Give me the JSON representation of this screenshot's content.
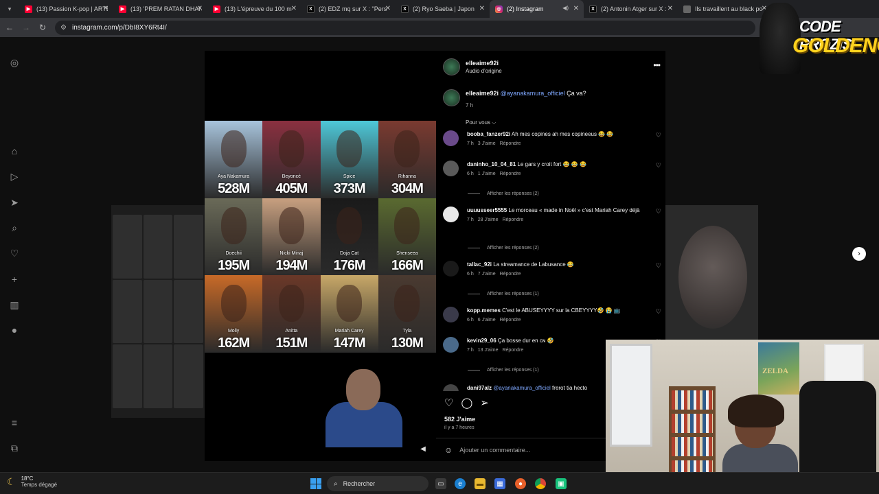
{
  "tabs": [
    {
      "title": "(13) Passion K-pop | ARTE",
      "favicon": "youtube",
      "active": false
    },
    {
      "title": "(13) 'PREM RATAN DHAN",
      "favicon": "youtube",
      "active": false
    },
    {
      "title": "(13) L'épreuve du 100 m",
      "favicon": "youtube",
      "active": false
    },
    {
      "title": "(2) EDZ mq sur X : \"Pers",
      "favicon": "x",
      "active": false
    },
    {
      "title": "(2) Ryo Saeba | Japon",
      "favicon": "x",
      "active": false
    },
    {
      "title": "(2) Instagram",
      "favicon": "instagram",
      "active": true
    },
    {
      "title": "(2) Antonin Atger sur X :",
      "favicon": "x",
      "active": false
    },
    {
      "title": "Ils travaillent au black po",
      "favicon": "none",
      "active": false
    }
  ],
  "url": "instagram.com/p/DbI8XY6Rt4I/",
  "reel": {
    "artists": [
      {
        "name": "Aya Nakamura",
        "streams": "528M",
        "color": "#a8c4dc"
      },
      {
        "name": "Beyoncé",
        "streams": "405M",
        "color": "#8a3040"
      },
      {
        "name": "Spice",
        "streams": "373M",
        "color": "#4ec8d8"
      },
      {
        "name": "Rihanna",
        "streams": "304M",
        "color": "#7a3a30"
      },
      {
        "name": "Doechii",
        "streams": "195M",
        "color": "#6a6a58"
      },
      {
        "name": "Nicki Minaj",
        "streams": "194M",
        "color": "#c8a080"
      },
      {
        "name": "Doja Cat",
        "streams": "176M",
        "color": "#1a1a1a"
      },
      {
        "name": "Shenseea",
        "streams": "166M",
        "color": "#5a6a30"
      },
      {
        "name": "Moliy",
        "streams": "162M",
        "color": "#c86a28"
      },
      {
        "name": "Anitta",
        "streams": "151M",
        "color": "#6a3828"
      },
      {
        "name": "Mariah Carey",
        "streams": "147M",
        "color": "#c8a868"
      },
      {
        "name": "Tyla",
        "streams": "130M",
        "color": "#4a3a30"
      }
    ]
  },
  "post": {
    "username": "elleaime92i",
    "audio": "Audio d'origine",
    "caption_user": "elleaime92i",
    "caption_mention": "@ayanakamura_officiel",
    "caption_text": " Ça va?",
    "caption_time": "7 h",
    "for_you": "Pour vous ⌵",
    "comments": [
      {
        "user": "booba_fanzer92i",
        "text": " Ah mes copines ah mes copineeus 😂 😂",
        "time": "7 h",
        "likes": "3 J'aime",
        "reply": "Répondre",
        "color": "#6a4a8a"
      },
      {
        "user": "daninho_10_04_81",
        "text": " Le gars y croit fort 😂 😂 😂",
        "time": "6 h",
        "likes": "1 J'aime",
        "reply": "Répondre",
        "color": "#5a5a5a"
      },
      {
        "user": "uuuusseer5555",
        "text": " Le morceau « made in Noël » c'est Mariah Carey déjà",
        "time": "7 h",
        "likes": "28 J'aime",
        "reply": "Répondre",
        "color": "#e8e8e8"
      },
      {
        "user": "tallac_92i",
        "text": " La streamance de Labusance 😂",
        "time": "6 h",
        "likes": "7 J'aime",
        "reply": "Répondre",
        "color": "#1a1a1a"
      },
      {
        "user": "kopp.memes",
        "text": " C'est le ABUSEYYYY sur la CBEYYYY🤣 😭 📺",
        "time": "6 h",
        "likes": "6 J'aime",
        "reply": "Répondre",
        "color": "#3a3a4a"
      },
      {
        "user": "kevin29_06",
        "text": " Ça bosse dur en ᴄɴ 🤣",
        "time": "7 h",
        "likes": "13 J'aime",
        "reply": "Répondre",
        "color": "#4a6a8a"
      }
    ],
    "replies": [
      "Afficher les réponses (2)",
      "Afficher les réponses (2)",
      "Afficher les réponses (1)",
      "Afficher les réponses (1)"
    ],
    "partial_comment_user": "dani97alz",
    "partial_comment_mention": "@ayanakamura_officiel",
    "partial_comment_text": " frerot tia hecto",
    "likes": "582 J'aime",
    "ago": "il y a 7 heures",
    "add_comment_placeholder": "Ajouter un commentaire..."
  },
  "overlay": {
    "logo_line1": "CODE PROZIS",
    "logo_line2": "GOLDENG",
    "poster_text": "ZELDA"
  },
  "taskbar": {
    "temperature": "18°C",
    "weather": "Temps dégagé",
    "search": "Rechercher"
  },
  "colors": {
    "instagram_link": "#7fa8ff",
    "windows_accent": "#3aa0f0",
    "logo_yellow": "#ffd21e"
  }
}
